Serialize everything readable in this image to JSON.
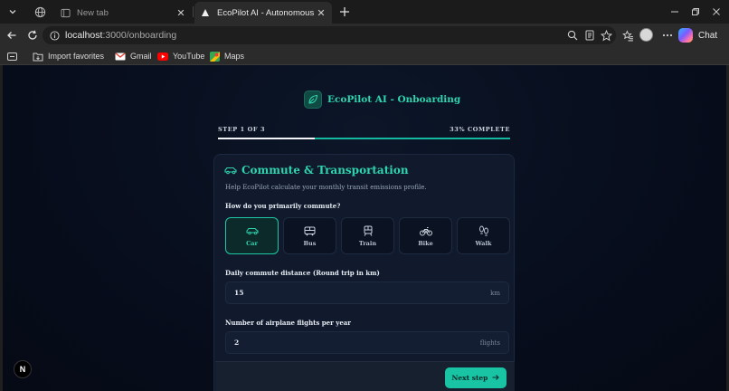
{
  "browser": {
    "tabs": [
      {
        "title": "New tab",
        "active": false
      },
      {
        "title": "EcoPilot AI - Autonomous Carbon",
        "active": true
      }
    ],
    "address": {
      "host": "localhost",
      "path": ":3000/onboarding"
    },
    "chat_label": "Chat",
    "bookmarks": [
      {
        "label": "Import favorites",
        "icon": "folder-icon"
      },
      {
        "label": "Gmail",
        "icon": "gmail-icon"
      },
      {
        "label": "YouTube",
        "icon": "youtube-icon"
      },
      {
        "label": "Maps",
        "icon": "maps-icon"
      }
    ]
  },
  "page": {
    "brand_title": "EcoPilot AI - Onboarding",
    "step_label": "STEP 1 OF 3",
    "progress_label": "33% COMPLETE",
    "progress_fraction": 0.33,
    "card": {
      "title": "Commute & Transportation",
      "subtitle": "Help EcoPilot calculate your monthly transit emissions profile.",
      "question": "How do you primarily commute?",
      "options": [
        {
          "label": "Car",
          "icon": "car-icon",
          "selected": true
        },
        {
          "label": "Bus",
          "icon": "bus-icon",
          "selected": false
        },
        {
          "label": "Train",
          "icon": "train-icon",
          "selected": false
        },
        {
          "label": "Bike",
          "icon": "bike-icon",
          "selected": false
        },
        {
          "label": "Walk",
          "icon": "footprints-icon",
          "selected": false
        }
      ],
      "distance_label": "Daily commute distance (Round trip in km)",
      "distance_value": "15",
      "distance_unit": "km",
      "flights_label": "Number of airplane flights per year",
      "flights_value": "2",
      "flights_unit": "flights",
      "next_button": "Next step"
    },
    "dev_badge": "N"
  },
  "colors": {
    "accent": "#2fd4ae",
    "button": "#18c4a3",
    "background": "#070d1c",
    "card": "#101a2c"
  }
}
